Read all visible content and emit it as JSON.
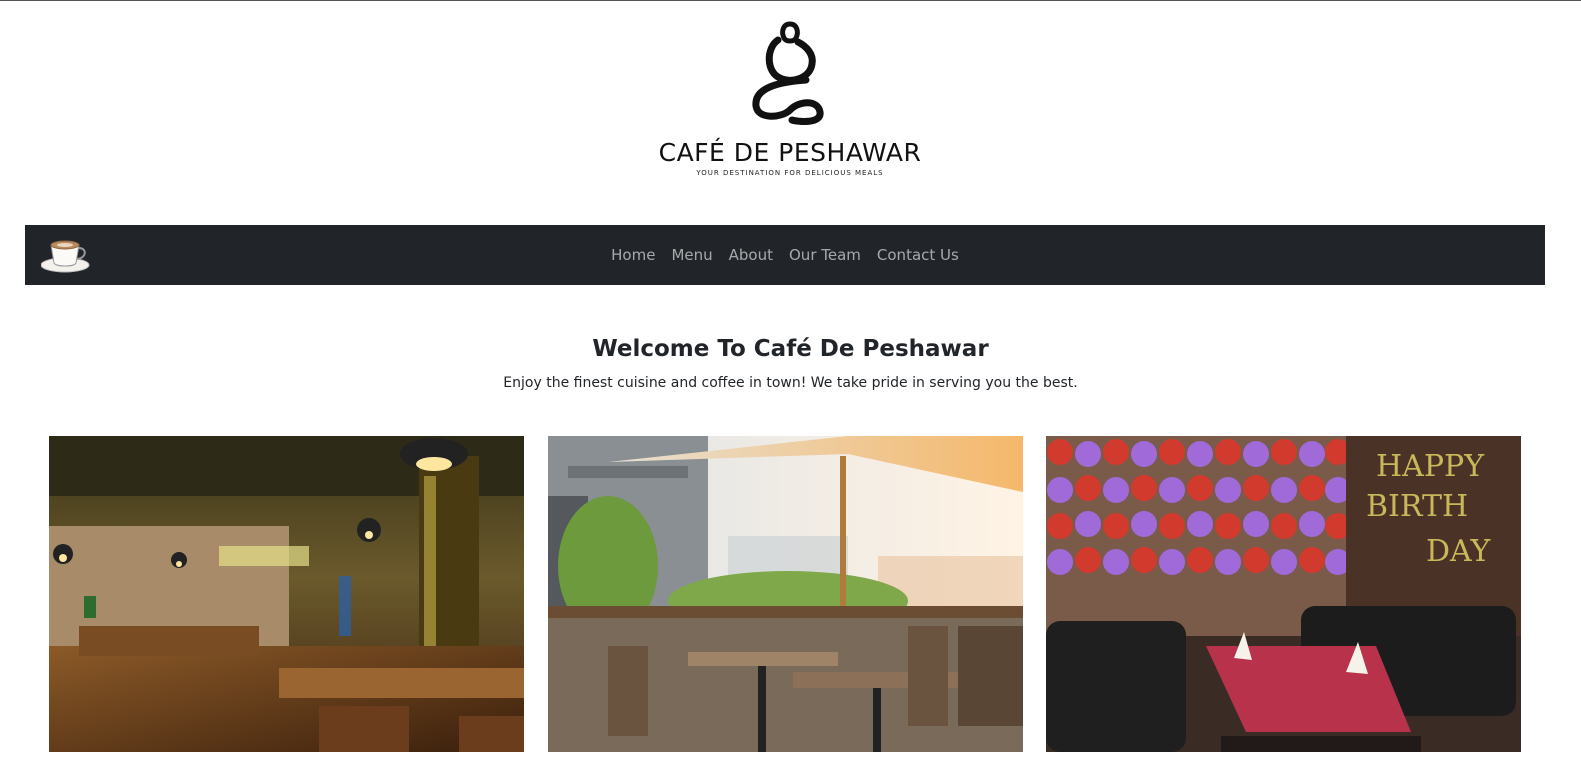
{
  "brand": {
    "logo_title": "CAFÉ DE PESHAWAR",
    "logo_tagline": "YOUR DESTINATION FOR DELICIOUS MEALS",
    "logo_icon": "meditating-figure-logo",
    "nav_icon": "coffee-cup-icon"
  },
  "nav": {
    "items": [
      {
        "label": "Home"
      },
      {
        "label": "Menu"
      },
      {
        "label": "About"
      },
      {
        "label": "Our Team"
      },
      {
        "label": "Contact Us"
      }
    ]
  },
  "intro": {
    "title": "Welcome To Café De Peshawar",
    "subtitle": "Enjoy the finest cuisine and coffee in town! We take pride in serving you the best."
  },
  "gallery": {
    "images": [
      {
        "subject": "indoor-dining-hall"
      },
      {
        "subject": "outdoor-terrace-umbrella"
      },
      {
        "subject": "birthday-lounge-balloons",
        "banner_text": "HAPPY BIRTHDAY"
      }
    ]
  },
  "colors": {
    "navbar_bg": "#212529",
    "nav_link": "rgba(255,255,255,0.6)",
    "text": "#212529"
  }
}
